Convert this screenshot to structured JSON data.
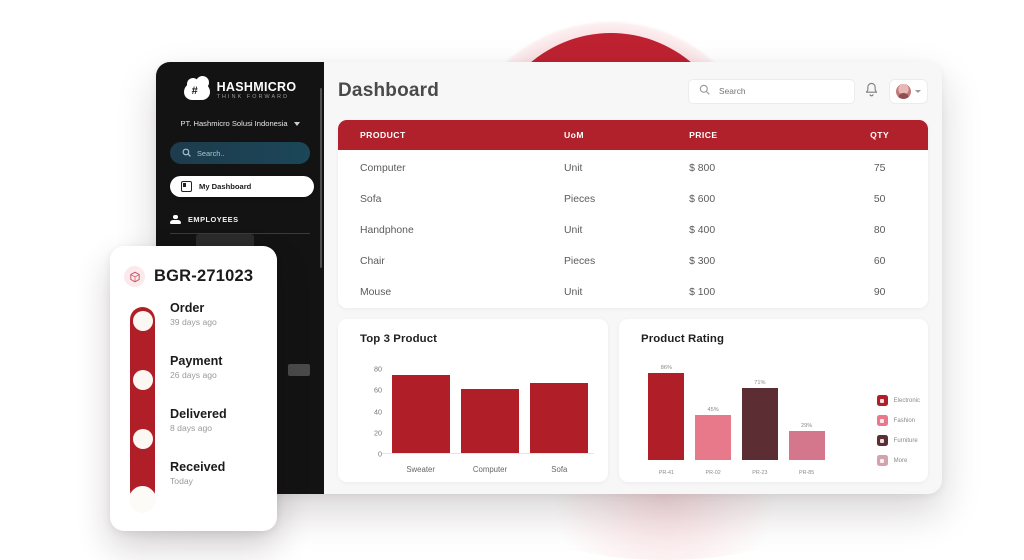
{
  "background": {
    "arc_color": "#BE2231",
    "arc_ring_color": "#F0B4BA"
  },
  "sidebar": {
    "logo_name": "HASHMICRO",
    "logo_tagline": "THINK FORWARD",
    "company": "PT. Hashmicro Solusi Indonesia",
    "search_placeholder": "Search..",
    "active_item": "My Dashboard",
    "section_label": "EMPLOYEES"
  },
  "header": {
    "title": "Dashboard",
    "search_placeholder": "Search",
    "search_value": ""
  },
  "table": {
    "columns": [
      "PRODUCT",
      "UoM",
      "PRICE",
      "QTY"
    ],
    "rows": [
      {
        "product": "Computer",
        "uom": "Unit",
        "price": "$ 800",
        "qty": "75"
      },
      {
        "product": "Sofa",
        "uom": "Pieces",
        "price": "$ 600",
        "qty": "50"
      },
      {
        "product": "Handphone",
        "uom": "Unit",
        "price": "$ 400",
        "qty": "80"
      },
      {
        "product": "Chair",
        "uom": "Pieces",
        "price": "$ 300",
        "qty": "60"
      },
      {
        "product": "Mouse",
        "uom": "Unit",
        "price": "$ 100",
        "qty": "90"
      }
    ]
  },
  "chart_data": [
    {
      "type": "bar",
      "title": "Top 3 Product",
      "categories": [
        "Sweater",
        "Computer",
        "Sofa"
      ],
      "values": [
        74,
        61,
        67
      ],
      "xlabel": "",
      "ylabel": "",
      "ylim": [
        0,
        80
      ],
      "yticks": [
        0,
        20,
        40,
        60,
        80
      ],
      "grid": false,
      "bar_color": "#B01F28"
    },
    {
      "type": "bar",
      "title": "Product Rating",
      "categories": [
        "PR-41",
        "PR-02",
        "PR-23",
        "PR-85"
      ],
      "values": [
        86,
        45,
        71,
        29
      ],
      "value_labels": [
        "86%",
        "45%",
        "71%",
        "29%"
      ],
      "bar_colors": [
        "#B01F28",
        "#E8798A",
        "#5C2E33",
        "#D4778C"
      ],
      "xlabel": "",
      "ylabel": "",
      "ylim": [
        0,
        100
      ],
      "grid": false,
      "legend_position": "right",
      "legend": [
        {
          "label": "Electronic",
          "color": "#B01F28"
        },
        {
          "label": "Fashion",
          "color": "#E8798A"
        },
        {
          "label": "Furniture",
          "color": "#5C2E33"
        },
        {
          "label": "More",
          "color": "#D4A1AC"
        }
      ]
    }
  ],
  "order_card": {
    "id": "BGR-271023",
    "steps": [
      {
        "name": "Order",
        "time": "39 days ago"
      },
      {
        "name": "Payment",
        "time": "26 days ago"
      },
      {
        "name": "Delivered",
        "time": "8 days ago"
      },
      {
        "name": "Received",
        "time": "Today"
      }
    ]
  }
}
